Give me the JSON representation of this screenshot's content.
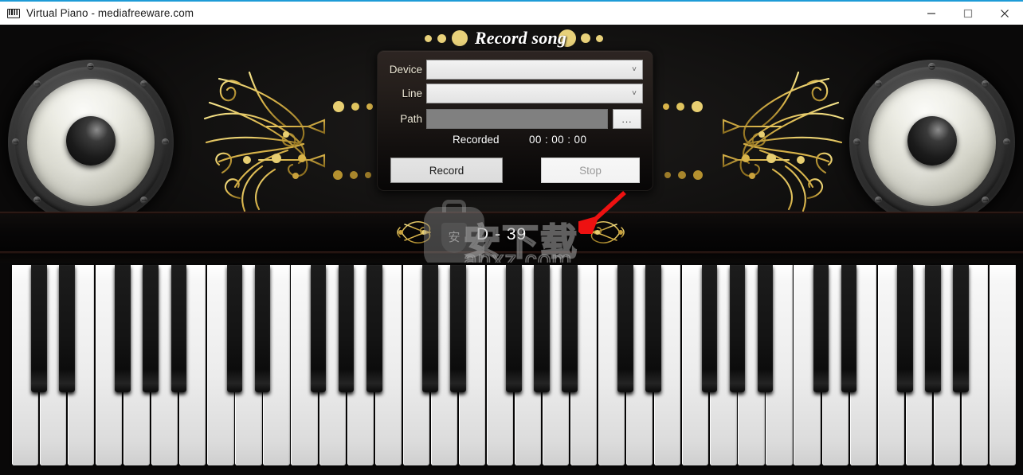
{
  "window": {
    "title": "Virtual Piano - mediafreeware.com",
    "icon": "piano-keyboard-icon",
    "controls": {
      "minimize": "minimize-icon",
      "maximize": "maximize-icon",
      "close": "close-icon"
    },
    "accent_color": "#1e9bd7"
  },
  "dialog": {
    "title": "Record song",
    "title_color": "#ffffff",
    "dot_color": "#e8d17a",
    "fields": {
      "device_label": "Device",
      "device_value": "",
      "device_placeholder": "",
      "line_label": "Line",
      "line_value": "",
      "line_placeholder": "",
      "path_label": "Path",
      "path_value": "",
      "browse_label": "..."
    },
    "status": {
      "recorded_label": "Recorded",
      "timer": "00 : 00 : 00"
    },
    "buttons": {
      "record": "Record",
      "stop": "Stop",
      "record_enabled": true,
      "stop_enabled": false
    }
  },
  "display": {
    "note_label": "D - 39"
  },
  "watermark": {
    "chinese_text": "安下载",
    "url_text": "anxz.com",
    "badge_glyph": "安"
  },
  "decor": {
    "speaker_left": "speaker-left",
    "speaker_right": "speaker-right",
    "ornament_left": "gold-filigree-left",
    "ornament_right": "gold-filigree-right",
    "gold_color": "#d9b44a",
    "arrow_color": "#ee1111"
  },
  "keyboard": {
    "white_key_count": 36,
    "white_key_color": "#f2f2f2",
    "black_key_color": "#131313",
    "pattern": "C D E F G A B",
    "octaves": 5
  }
}
